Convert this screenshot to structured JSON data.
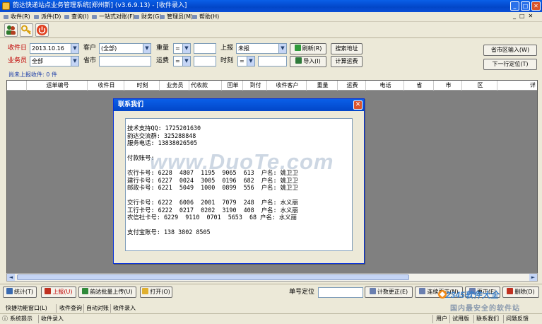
{
  "window": {
    "title": "韵达快递站点业务管理系统[郑州新] (v3.6.9.13) - [收件录入]"
  },
  "menu": [
    "收件(R)",
    "派件(D)",
    "查询(I)",
    "一站式对账(F)",
    "财务(G)",
    "管理员(M)",
    "帮助(H)"
  ],
  "filters": {
    "date_label": "收件日",
    "date_value": "2013.10.16",
    "customer_label": "客户",
    "customer_value": "(全部)",
    "weight_label": "重量",
    "weight_op": "=",
    "upload_label": "上报",
    "upload_value": "未报",
    "refresh_label": "刷新(R)",
    "search_addr_label": "搜索地址",
    "salesman_label": "业务员",
    "salesman_value": "全部",
    "province_label": "省市",
    "freight_label": "运费",
    "freight_op": "=",
    "time_label": "时刻",
    "time_op": "=",
    "import_label": "导入(I)",
    "calc_freight_label": "计算运费",
    "province_input_label": "省市区输入(W)",
    "next_row_label": "下一行定位(T)"
  },
  "unreported": "尚未上报收件: 0 件",
  "grid": {
    "columns": [
      "运单编号",
      "收件日",
      "时刻",
      "业务员",
      "代收款",
      "回单",
      "到付",
      "收件客户",
      "重量",
      "运费",
      "电话",
      "省",
      "市",
      "区",
      "详"
    ]
  },
  "dialog": {
    "title": "联系我们",
    "close": "✕",
    "text": "技术支持QQ: 1725201630\n韵达交流群: 325288848\n服务电话: 13838026505\n\n付款账号:\n\n农行卡号: 6228  4807  1195  9065  613  户名: 姚卫卫\n建行卡号: 6227  0024  3005  0196  682  户名: 姚卫卫\n邮政卡号: 6221  5049  1000  0899  556  户名: 姚卫卫\n\n交行卡号: 6222  6006  2001  7079  248  户名: 水义丽\n工行卡号: 6222  0217  0202  3190  408  户名: 水义丽\n农信社卡号: 6229  9110  0701  5653  68 户名: 水义丽\n\n支付宝账号: 138 3802 8505"
  },
  "watermark": "www.DuoTe.com",
  "bottom": {
    "stats": "统计(T)",
    "upload": "上报(U)",
    "batch_upload": "韵达批量上传(U)",
    "open": "打开(O)",
    "locate_label": "单号定位",
    "count_edit": "计数更正(E)",
    "continuous_edit": "连续更正(N)",
    "edit": "更正(E)",
    "delete": "删除(D)"
  },
  "status": {
    "tabs": [
      "快捷功能窗口(L)",
      "收件查询",
      "自动对账",
      "收件录入"
    ],
    "hint_label": "系统提示",
    "hint_value": "收件录入",
    "user_label": "用户",
    "trial": "试用版",
    "contact": "联系我们",
    "feedback": "问题反馈"
  },
  "logo": {
    "text": "2345软件大全",
    "slogan": "国内最安全的软件站"
  }
}
